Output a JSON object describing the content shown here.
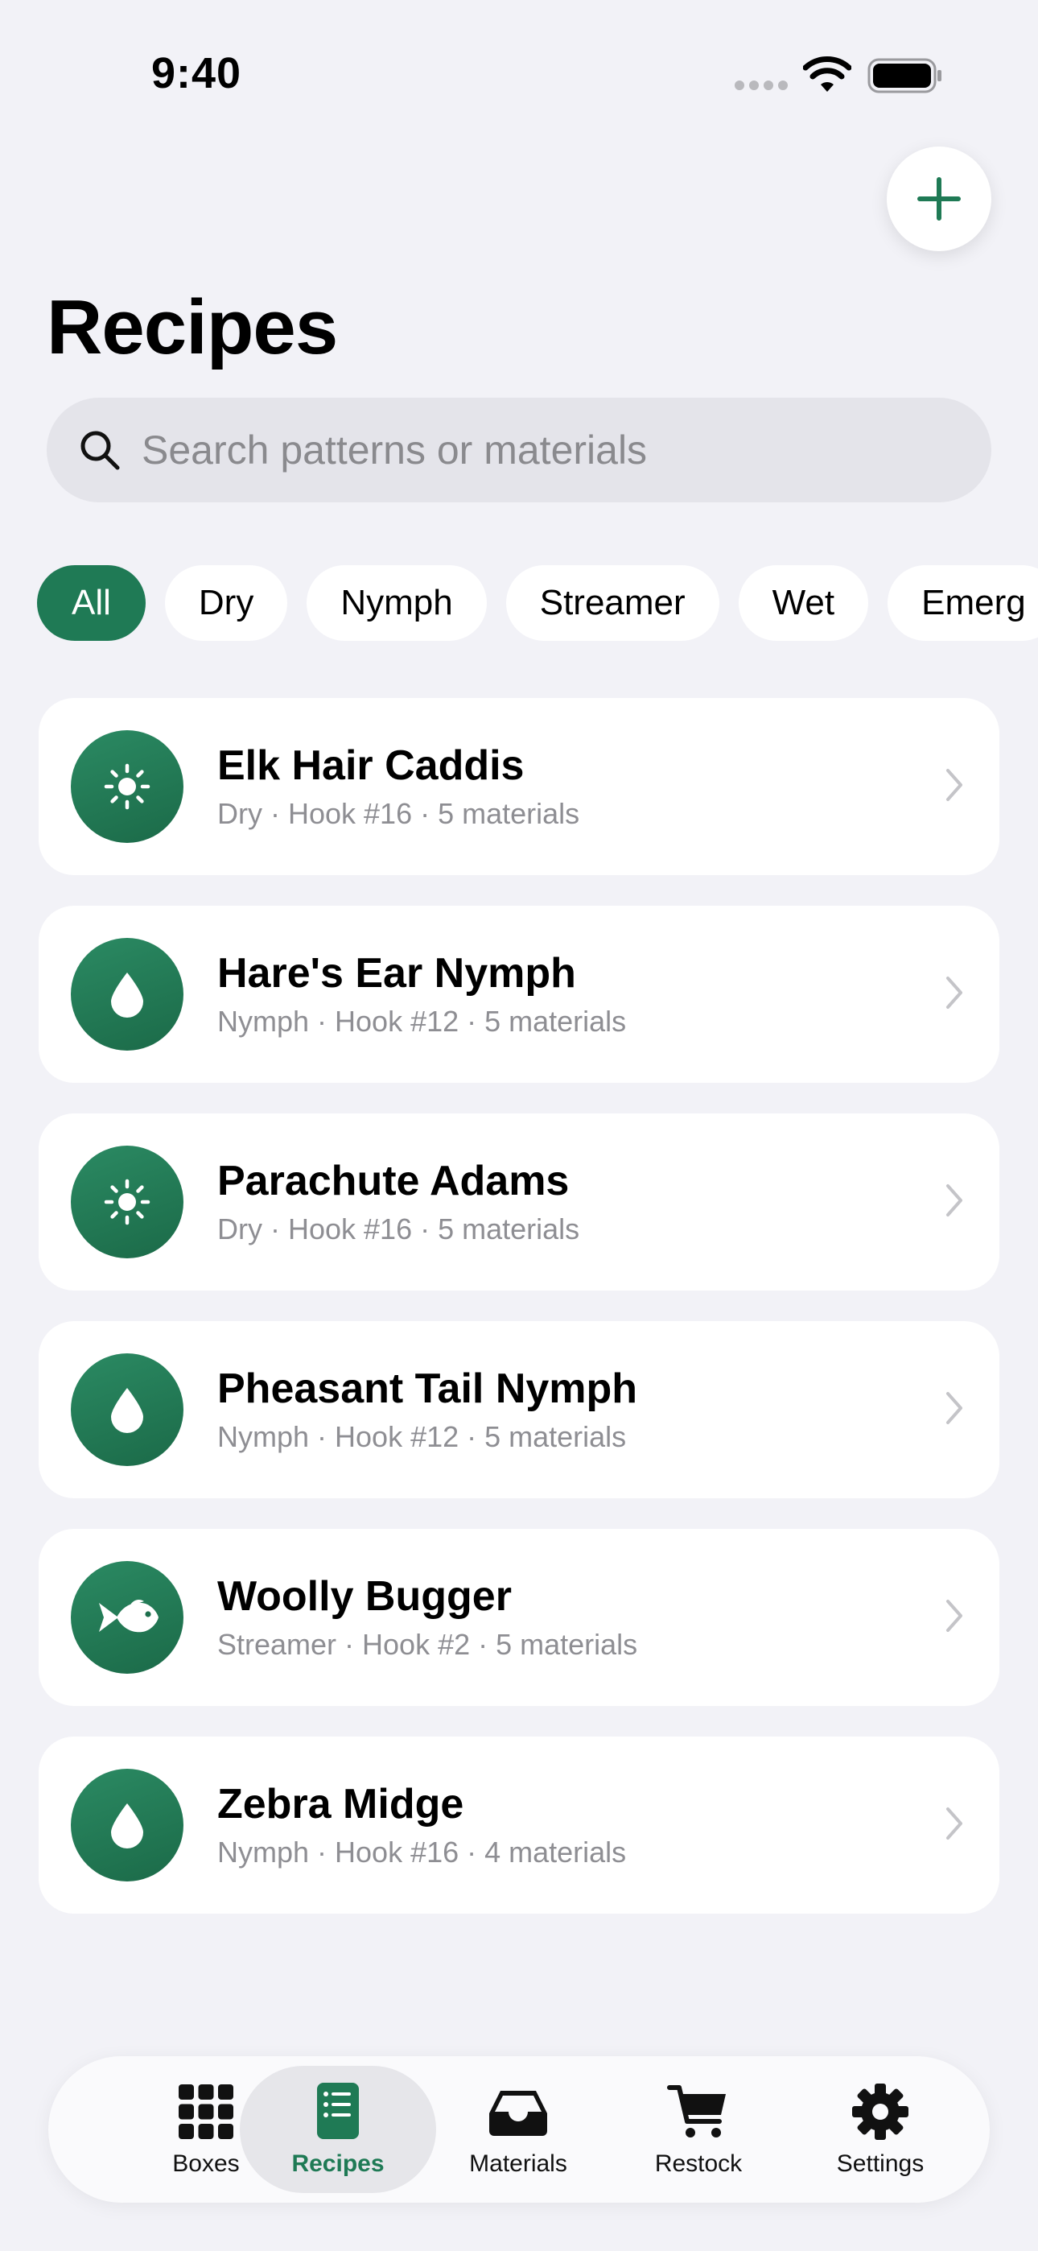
{
  "status_bar": {
    "time": "9:40"
  },
  "header": {
    "title": "Recipes",
    "add_icon": "plus-icon"
  },
  "search": {
    "placeholder": "Search patterns or materials",
    "value": ""
  },
  "filters": [
    {
      "label": "All",
      "active": true
    },
    {
      "label": "Dry",
      "active": false
    },
    {
      "label": "Nymph",
      "active": false
    },
    {
      "label": "Streamer",
      "active": false
    },
    {
      "label": "Wet",
      "active": false
    },
    {
      "label": "Emerg",
      "active": false
    }
  ],
  "recipes": [
    {
      "name": "Elk Hair Caddis",
      "meta": "Dry · Hook #16 · 5 materials",
      "icon": "sun-icon"
    },
    {
      "name": "Hare's Ear Nymph",
      "meta": "Nymph · Hook #12 · 5 materials",
      "icon": "drop-icon"
    },
    {
      "name": "Parachute Adams",
      "meta": "Dry · Hook #16 · 5 materials",
      "icon": "sun-icon"
    },
    {
      "name": "Pheasant Tail Nymph",
      "meta": "Nymph · Hook #12 · 5 materials",
      "icon": "drop-icon"
    },
    {
      "name": "Woolly Bugger",
      "meta": "Streamer · Hook #2 · 5 materials",
      "icon": "fish-icon"
    },
    {
      "name": "Zebra Midge",
      "meta": "Nymph · Hook #16 · 4 materials",
      "icon": "drop-icon"
    }
  ],
  "tabs": [
    {
      "label": "Boxes",
      "icon": "grid-icon",
      "active": false
    },
    {
      "label": "Recipes",
      "icon": "list-icon",
      "active": true
    },
    {
      "label": "Materials",
      "icon": "tray-icon",
      "active": false
    },
    {
      "label": "Restock",
      "icon": "cart-icon",
      "active": false
    },
    {
      "label": "Settings",
      "icon": "gear-icon",
      "active": false
    }
  ],
  "colors": {
    "accent": "#1f7a55",
    "background": "#f2f2f7",
    "secondary_text": "#8e8e93"
  }
}
